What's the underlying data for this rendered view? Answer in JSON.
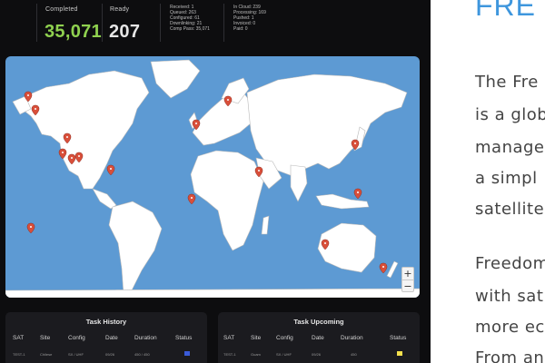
{
  "top_stats": {
    "completed_label": "Completed",
    "completed_value": "35,071",
    "ready_label": "Ready",
    "ready_value": "207",
    "status_left": [
      "Received: 1",
      "Queued: 263",
      "Configured: 61",
      "Downlinking: 21",
      "Comp Pass: 35,071"
    ],
    "status_right": [
      "In Cloud: 239",
      "Processing: 169",
      "Pushed: 1",
      "Invoiced: 0",
      "Paid: 0"
    ]
  },
  "colors": {
    "completed": "#8fd14f",
    "ready": "#e6e6e6",
    "map_water": "#5d9ad3",
    "pin": "#d94f3a",
    "link": "#3e96dd"
  },
  "map": {
    "zoom_in": "+",
    "zoom_out": "−",
    "pin_icon": "map-pin-icon"
  },
  "task_history": {
    "title": "Task History",
    "headers": [
      "SAT",
      "Site",
      "Config",
      "Date",
      "Duration",
      "Status"
    ],
    "row": [
      "TEST-1",
      "Chilese",
      "SX / UHF",
      "09/26",
      "450 / 450"
    ],
    "status_color": "#3a5bd9"
  },
  "task_upcoming": {
    "title": "Task Upcoming",
    "headers": [
      "SAT",
      "Site",
      "Config",
      "Date",
      "Duration",
      "Status"
    ],
    "row": [
      "TEST-1",
      "Guam",
      "SX / UHF",
      "09/26",
      "450"
    ],
    "status_color": "#f4e04d"
  },
  "article": {
    "title": "FRE",
    "lines": [
      "The Fre",
      "is a glob",
      "manage",
      "a simpl",
      "satellite",
      "Freedom",
      "with sat",
      "more ec",
      "From an"
    ]
  }
}
